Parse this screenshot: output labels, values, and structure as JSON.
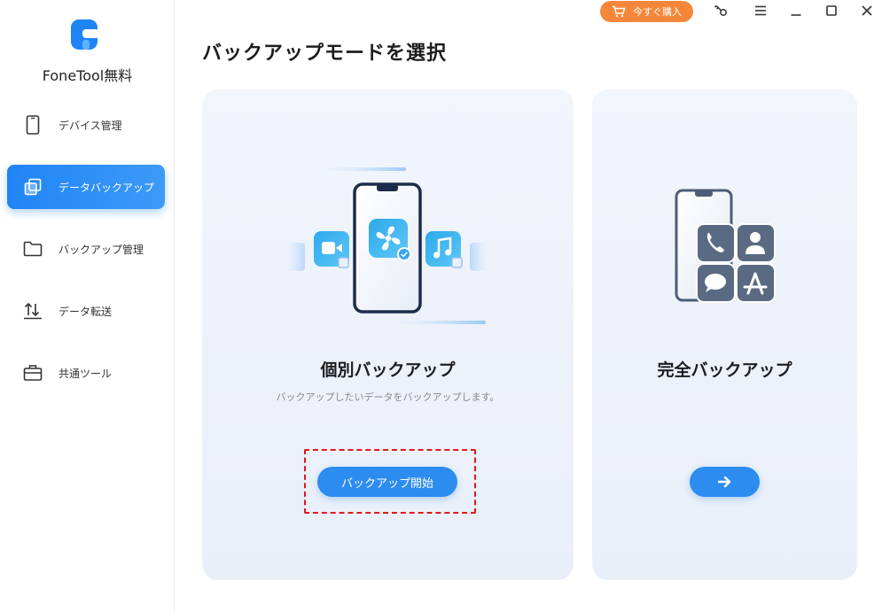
{
  "app": {
    "name": "FoneTool無料"
  },
  "header": {
    "buy_label": "今すぐ購入",
    "icons": [
      "cart-icon",
      "key-icon",
      "menu-icon",
      "minimize-icon",
      "maximize-icon",
      "close-icon"
    ]
  },
  "sidebar": {
    "items": [
      {
        "label": "デバイス管理",
        "icon": "phone-icon",
        "active": false
      },
      {
        "label": "データバックアップ",
        "icon": "copy-icon",
        "active": true
      },
      {
        "label": "バックアップ管理",
        "icon": "folder-icon",
        "active": false
      },
      {
        "label": "データ転送",
        "icon": "transfer-icon",
        "active": false
      },
      {
        "label": "共通ツール",
        "icon": "toolbox-icon",
        "active": false
      }
    ]
  },
  "main": {
    "title": "バックアップモードを選択",
    "cards": [
      {
        "title": "個別バックアップ",
        "description": "バックアップしたいデータをバックアップします。",
        "button_label": "バックアップ開始"
      },
      {
        "title": "完全バックアップ",
        "button_label": "→"
      }
    ]
  },
  "colors": {
    "accent": "#2d8cf0",
    "buy": "#f6873a",
    "highlight": "#e0181b",
    "card_bg": "#eef3fb"
  }
}
